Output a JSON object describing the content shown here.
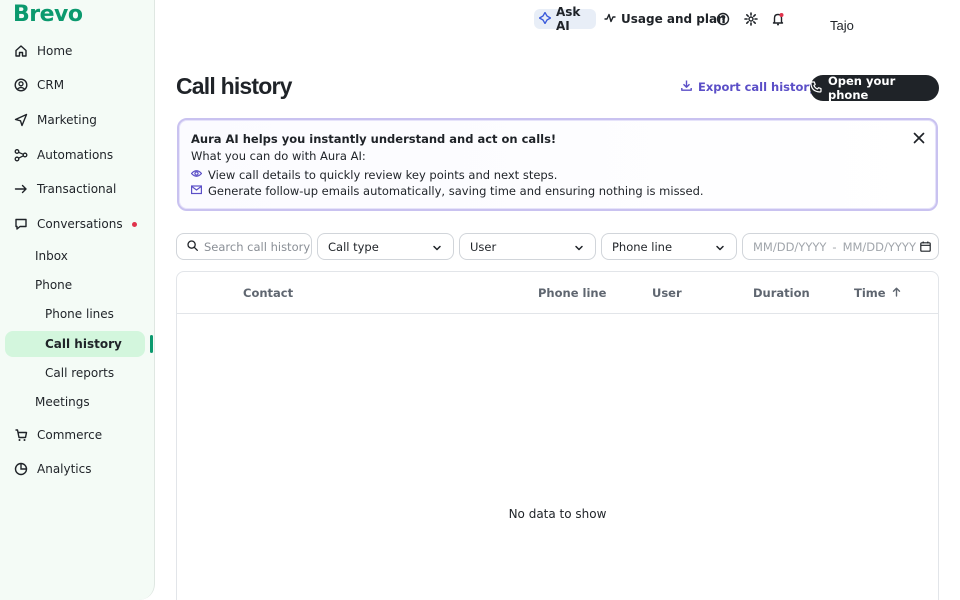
{
  "brand": {
    "logo": "Brevo",
    "accent": "#0b996e"
  },
  "sidebar": {
    "items": [
      {
        "label": "Home",
        "icon": "home-icon"
      },
      {
        "label": "CRM",
        "icon": "contacts-icon"
      },
      {
        "label": "Marketing",
        "icon": "send-icon"
      },
      {
        "label": "Automations",
        "icon": "automation-icon"
      },
      {
        "label": "Transactional",
        "icon": "arrow-right-icon"
      },
      {
        "label": "Conversations",
        "icon": "chat-icon"
      },
      {
        "label": "Commerce",
        "icon": "cart-icon"
      },
      {
        "label": "Analytics",
        "icon": "pie-chart-icon"
      }
    ],
    "sub": {
      "inbox": "Inbox",
      "phone": "Phone",
      "phone_lines": "Phone lines",
      "call_history": "Call history",
      "call_reports": "Call reports",
      "meetings": "Meetings"
    }
  },
  "topbar": {
    "ask_ai": "Ask AI",
    "usage": "Usage and plan",
    "user": "Tajo"
  },
  "page": {
    "title": "Call history",
    "export_label": "Export call history",
    "open_phone_label": "Open your phone"
  },
  "banner": {
    "title": "Aura AI helps you instantly understand and act on calls!",
    "subtitle": "What you can do with Aura AI:",
    "line1": "View call details to quickly review key points and next steps.",
    "line2": "Generate follow-up emails automatically, saving time and ensuring nothing is missed."
  },
  "filters": {
    "search_placeholder": "Search call history",
    "call_type": "Call type",
    "user": "User",
    "phone_line": "Phone line",
    "date_from": "MM/DD/YYYY",
    "date_sep": "-",
    "date_to": "MM/DD/YYYY"
  },
  "table": {
    "columns": [
      "Contact",
      "Phone line",
      "User",
      "Duration",
      "Time"
    ],
    "empty": "No data to show"
  }
}
